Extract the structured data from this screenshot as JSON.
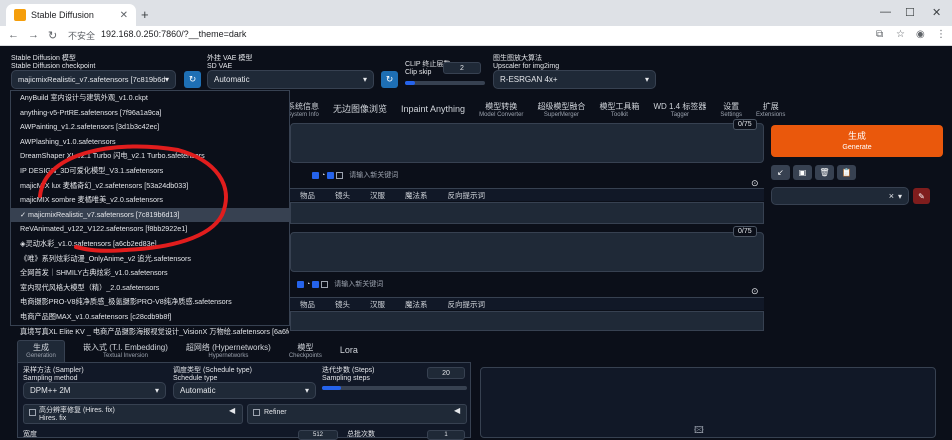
{
  "browser": {
    "tab_title": "Stable Diffusion",
    "new_tab": "+",
    "address_warning": "不安全",
    "url": "192.168.0.250:7860/?__theme=dark"
  },
  "top": {
    "checkpoint_label_cn": "Stable Diffusion 模型",
    "checkpoint_label_en": "Stable Diffusion checkpoint",
    "checkpoint_value": "majicmixRealistic_v7.safetensors [7c819b6d13]",
    "vae_label_cn": "外挂 VAE 模型",
    "vae_label_en": "SD VAE",
    "vae_value": "Automatic",
    "clip_label_cn": "CLIP 终止层数",
    "clip_label_en": "Clip skip",
    "clip_value": "2",
    "upscaler_label_cn": "图生图放大算法",
    "upscaler_label_en": "Upscaler for img2img",
    "upscaler_value": "R-ESRGAN 4x+",
    "refresh_icon": "↻"
  },
  "dropdown": {
    "items": [
      "AnyBuild 室内设计与建筑外观_v1.0.ckpt",
      "anything-v5-PrtRE.safetensors [7f96a1a9ca]",
      "AWPainting_v1.2.safetensors [3d1b3c42ec]",
      "AWPlashing_v1.0.safetensors",
      "DreamShaper XL v2.1 Turbo 闪电_v2.1 Turbo.safetensors",
      "IP DESIGN_3D可爱化模型_V3.1.safetensors",
      "majicMIX lux 麦橘奇幻_v2.safetensors [53a24db033]",
      "majicMIX sombre 麦橘唯美_v2.0.safetensors",
      "✓ majicmixRealistic_v7.safetensors [7c819b6d13]",
      "ReVAnimated_v122_V122.safetensors [f8bb2922e1]",
      "◈灵动水彩_v1.0.safetensors [a6cb2ed83e]",
      "《唯》系列炫彩动漫_OnlyAnime_v2 追光.safetensors",
      "全网首发｜SHMILY古典炫彩_v1.0.safetensors",
      "室内现代风格大模型（精）_2.0.safetensors",
      "电商摄影PRO-V8纯净质感_极氪摄影PRO-V8纯净质感.safetensors",
      "电商产品图MAX_v1.0.safetensors [c28cdb9b8f]",
      "真境写真XL Elite KV _ 电商产品摄影海报视觉设计_VisionX 万物绘.safetensors [6a6fcb844f]"
    ],
    "selected_index": 8
  },
  "main_tabs": [
    {
      "cn": "系统信息",
      "en": "System Info"
    },
    {
      "cn": "无边图像浏览",
      "en": ""
    },
    {
      "cn": "Inpaint Anything",
      "en": ""
    },
    {
      "cn": "模型转换",
      "en": "Model Converter"
    },
    {
      "cn": "超级模型融合",
      "en": "SuperMerger"
    },
    {
      "cn": "模型工具箱",
      "en": "Toolkit"
    },
    {
      "cn": "WD 1.4 标签器",
      "en": "Tagger"
    },
    {
      "cn": "设置",
      "en": "Settings"
    },
    {
      "cn": "扩展",
      "en": "Extensions"
    }
  ],
  "prompt": {
    "counter": "0/75",
    "keyword_placeholder": "请输入新关键词",
    "chips": [
      "物品",
      "镜头",
      "汉服",
      "魔法系",
      "反向提示词"
    ]
  },
  "neg_prompt": {
    "counter": "0/75",
    "keyword_placeholder": "请输入新关键词",
    "chips": [
      "物品",
      "镜头",
      "汉服",
      "魔法系",
      "反向提示词"
    ]
  },
  "generate": {
    "cn": "生成",
    "en": "Generate"
  },
  "style_clear": "×",
  "gen_tabs": [
    {
      "cn": "生成",
      "en": "Generation"
    },
    {
      "cn": "嵌入式 (T.I. Embedding)",
      "en": "Textual Inversion"
    },
    {
      "cn": "超网络 (Hypernetworks)",
      "en": "Hypernetworks"
    },
    {
      "cn": "模型",
      "en": "Checkpoints"
    },
    {
      "cn": "Lora",
      "en": ""
    }
  ],
  "sampler": {
    "label_cn": "采样方法 (Sampler)",
    "label_en": "Sampling method",
    "value": "DPM++ 2M"
  },
  "schedule": {
    "label_cn": "调度类型 (Schedule type)",
    "label_en": "Schedule type",
    "value": "Automatic"
  },
  "steps": {
    "label_cn": "迭代步数 (Steps)",
    "label_en": "Sampling steps",
    "value": "20",
    "fraction": 0.13
  },
  "hires": {
    "label_cn": "高分辨率修复 (Hires. fix)",
    "label_en": "Hires. fix"
  },
  "refiner": {
    "label": "Refiner"
  },
  "width": {
    "label_cn": "宽度",
    "value": "512"
  },
  "batch": {
    "label_cn": "总批次数",
    "value": "1"
  },
  "colors": {
    "accent": "#ea580c",
    "blue": "#1e6fb4",
    "bg": "#0b0f19"
  }
}
